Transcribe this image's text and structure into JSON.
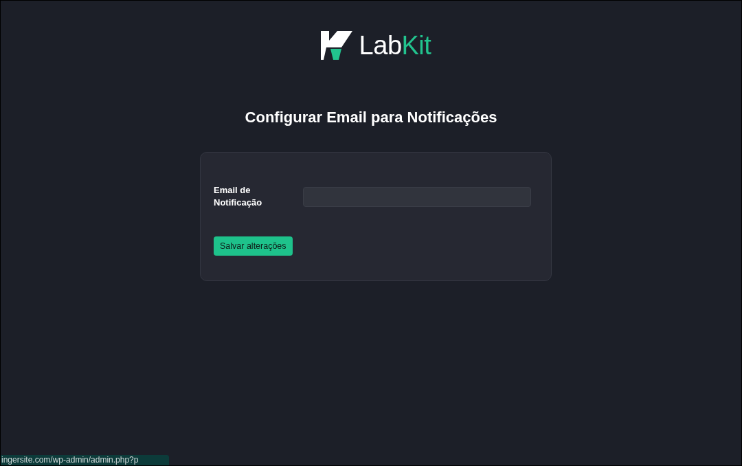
{
  "logo": {
    "parts": [
      {
        "text": "Lab",
        "color": "#ffffff"
      },
      {
        "text": "Kit",
        "color": "#22c38e"
      }
    ]
  },
  "title": "Configurar Email para Notificações",
  "form": {
    "fields": [
      {
        "label": "Email de Notificação"
      }
    ],
    "submit": "Salvar alterações"
  },
  "status_bar": {
    "url": "ingersite.com/wp-admin/admin.php?p"
  }
}
